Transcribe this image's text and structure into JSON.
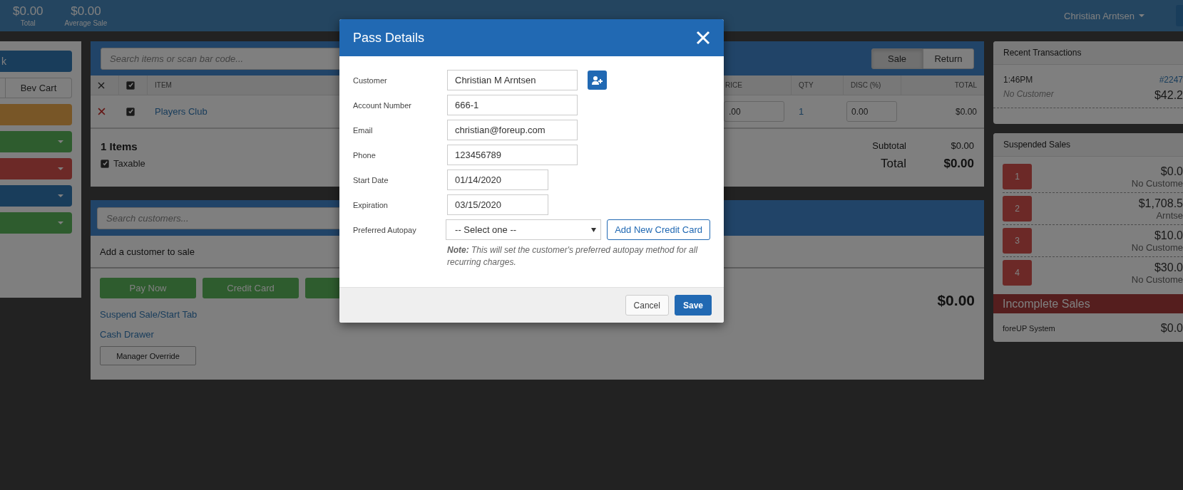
{
  "top_bar": {
    "stats": [
      {
        "value": "$0.00",
        "label": "Total"
      },
      {
        "value": "$0.00",
        "label": "Average Sale"
      }
    ],
    "user": "Christian Arntsen"
  },
  "left_panel": {
    "buttons": [
      {
        "kind": "primary",
        "label": "k",
        "dropdown": false
      },
      {
        "kind": "group",
        "label": "Bev Cart"
      },
      {
        "kind": "warning",
        "dropdown": false
      },
      {
        "kind": "success",
        "dropdown": true
      },
      {
        "kind": "danger",
        "dropdown": true
      },
      {
        "kind": "primary",
        "dropdown": true
      },
      {
        "kind": "success",
        "dropdown": true
      }
    ]
  },
  "sale": {
    "search": {
      "placeholder": "Search items or scan bar code..."
    },
    "modes": [
      {
        "label": "Sale",
        "selected": true
      },
      {
        "label": "Return",
        "selected": false
      }
    ],
    "header_checked": true,
    "columns": [
      "ITEM",
      "RICE",
      "QTY",
      "DISC (%)",
      "TOTAL"
    ],
    "rows": [
      {
        "checked": true,
        "item": "Players Club",
        "price": ".00",
        "qty": "1",
        "discount": "0.00",
        "total": "$0.00"
      }
    ],
    "items_count": "1 Items",
    "taxable": {
      "label": "Taxable",
      "checked": true
    },
    "subtotal": {
      "label": "Subtotal",
      "value": "$0.00"
    },
    "total": {
      "label": "Total",
      "value": "$0.00"
    }
  },
  "customer": {
    "search": {
      "placeholder": "Search customers..."
    },
    "prompt": "Add a customer to sale",
    "payment_buttons": [
      "Pay Now",
      "Credit Card"
    ],
    "links": [
      "Suspend Sale/Start Tab",
      "Cash Drawer"
    ],
    "override": "Manager Override",
    "amount_due": "$0.00"
  },
  "recent_transactions": {
    "title": "Recent Transactions",
    "items": [
      {
        "time": "1:46PM",
        "number": "#2247",
        "customer": "No Customer",
        "amount": "$42.2"
      }
    ]
  },
  "suspended_sales": {
    "title": "Suspended Sales",
    "items": [
      {
        "number": "1",
        "amount": "$0.0",
        "customer": "No Custome"
      },
      {
        "number": "2",
        "amount": "$1,708.5",
        "customer": "Arntse"
      },
      {
        "number": "3",
        "amount": "$10.0",
        "customer": "No Custome"
      },
      {
        "number": "4",
        "amount": "$30.0",
        "customer": "No Custome"
      }
    ]
  },
  "incomplete_sales": {
    "title": "Incomplete Sales",
    "items": [
      {
        "source": "foreUP System",
        "amount": "$0.0"
      }
    ]
  },
  "dialog": {
    "title": "Pass Details",
    "fields": [
      {
        "kind": "lookup",
        "label": "Customer",
        "value": "Christian M Arntsen"
      },
      {
        "kind": "text",
        "label": "Account Number",
        "value": "666-1"
      },
      {
        "kind": "text",
        "label": "Email",
        "value": "christian@foreup.com"
      },
      {
        "kind": "text",
        "label": "Phone",
        "value": "123456789"
      },
      {
        "kind": "date",
        "label": "Start Date",
        "value": "01/14/2020"
      },
      {
        "kind": "date",
        "label": "Expiration",
        "value": "03/15/2020"
      }
    ],
    "autopay": {
      "label": "Preferred Autopay",
      "value": "-- Select one --",
      "button": "Add New Credit Card"
    },
    "note": "**Note:** This will set the customer's preferred autopay method for all recurring charges.",
    "buttons": [
      {
        "kind": "default",
        "label": "Cancel"
      },
      {
        "kind": "primary",
        "label": "Save"
      }
    ]
  }
}
